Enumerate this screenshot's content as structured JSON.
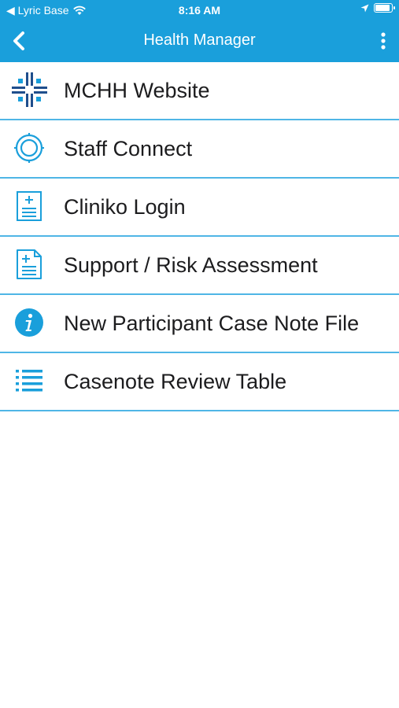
{
  "status_bar": {
    "back_app": "◀ Lyric Base",
    "time": "8:16 AM"
  },
  "nav": {
    "title": "Health Manager"
  },
  "menu": {
    "items": [
      {
        "label": "MCHH Website",
        "icon": "mchh-logo-icon"
      },
      {
        "label": "Staff Connect",
        "icon": "target-circle-icon"
      },
      {
        "label": "Cliniko Login",
        "icon": "document-plus-icon"
      },
      {
        "label": "Support / Risk Assessment",
        "icon": "document-plus-icon"
      },
      {
        "label": "New Participant Case Note File",
        "icon": "info-icon"
      },
      {
        "label": "Casenote Review Table",
        "icon": "list-icon"
      }
    ]
  },
  "colors": {
    "accent": "#1a9fdb",
    "icon_blue": "#1a9fdb",
    "logo_navy": "#1f4e8c",
    "divider": "#4fb6e6"
  }
}
